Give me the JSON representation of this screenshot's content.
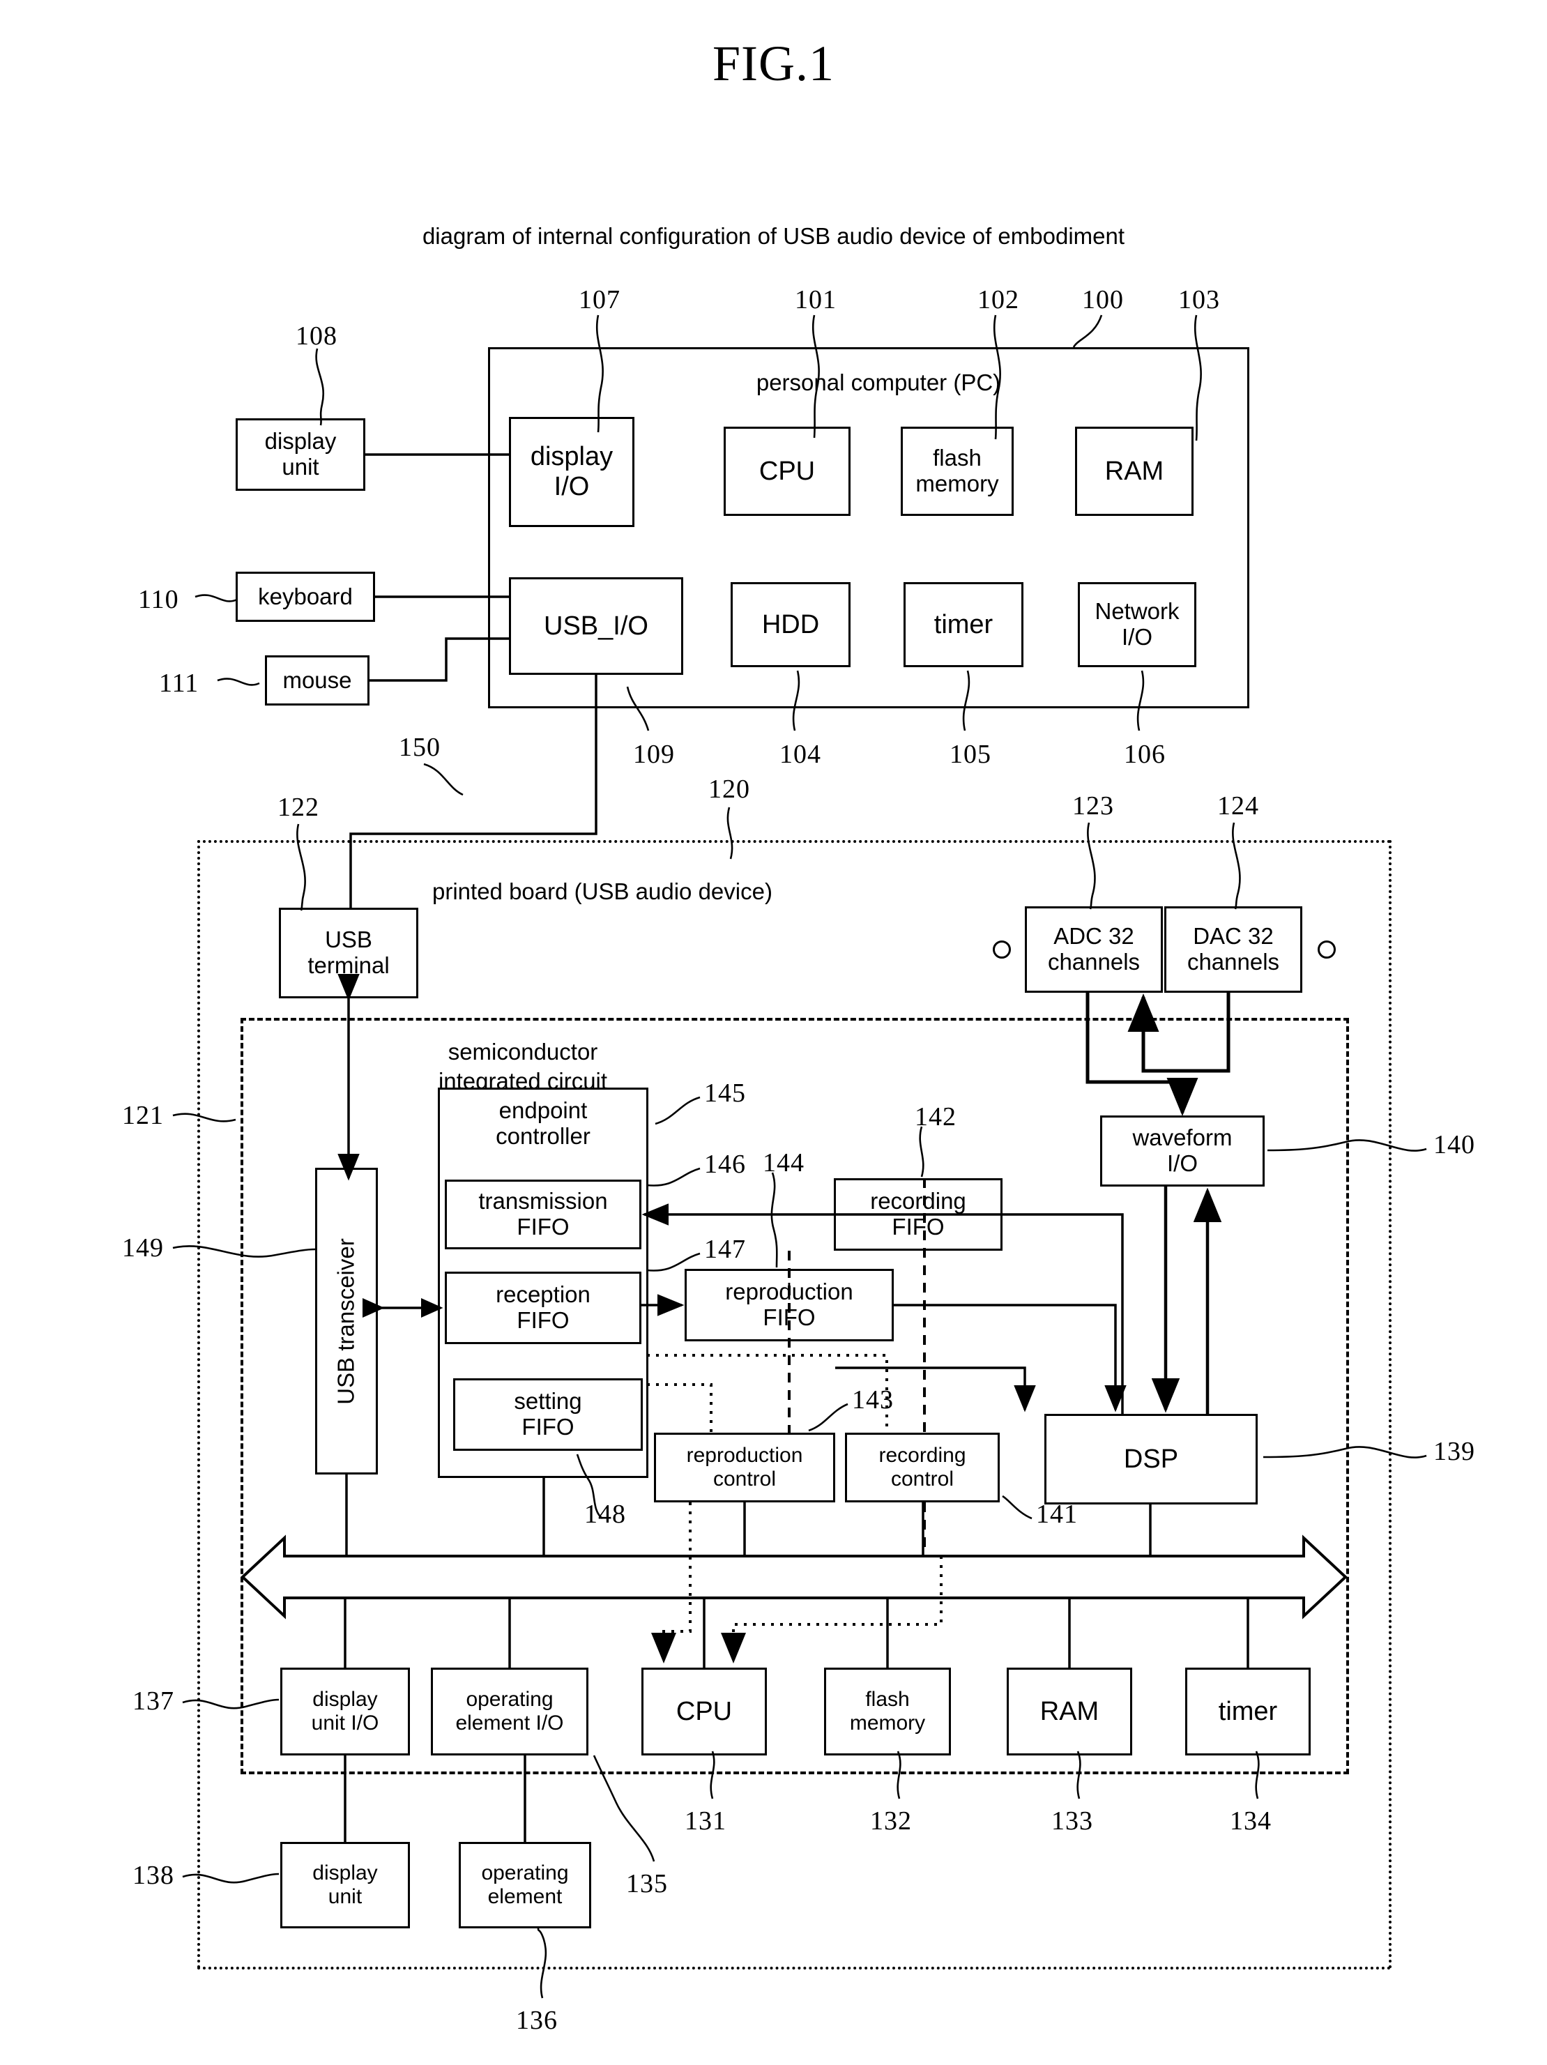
{
  "figure": {
    "title": "FIG.1",
    "caption": "diagram of internal configuration of USB audio device of embodiment"
  },
  "pc": {
    "title": "personal computer (PC)",
    "ref": "100",
    "blocks": [
      {
        "label": "display\nI/O",
        "ref": "107"
      },
      {
        "label": "CPU",
        "ref": "101"
      },
      {
        "label": "flash\nmemory",
        "ref": "102"
      },
      {
        "label": "RAM",
        "ref": "103"
      },
      {
        "label": "USB_I/O",
        "ref": "109"
      },
      {
        "label": "HDD",
        "ref": "104"
      },
      {
        "label": "timer",
        "ref": "105"
      },
      {
        "label": "Network\nI/O",
        "ref": "106"
      }
    ],
    "peripherals": [
      {
        "label": "display\nunit",
        "ref": "108"
      },
      {
        "label": "keyboard",
        "ref": "110"
      },
      {
        "label": "mouse",
        "ref": "111"
      }
    ]
  },
  "cable": {
    "ref": "150"
  },
  "board": {
    "title": "printed board (USB audio device)",
    "ref": "120",
    "usb_terminal": {
      "label": "USB\nterminal",
      "ref": "122"
    },
    "converters": [
      {
        "label": "ADC 32\nchannels",
        "ref": "123"
      },
      {
        "label": "DAC 32\nchannels",
        "ref": "124"
      }
    ],
    "external": [
      {
        "label": "display\nunit",
        "ref": "138"
      },
      {
        "label": "operating\nelement",
        "ref": "136"
      }
    ]
  },
  "ic": {
    "title": "semiconductor\nintegrated circuit",
    "title_line1": "semiconductor",
    "title_line2": "integrated circuit",
    "ref": "121",
    "transceiver": {
      "label": "USB transceiver",
      "ref": "149"
    },
    "endpoint_controller": {
      "label": "endpoint\ncontroller",
      "ref": "145"
    },
    "fifos": [
      {
        "label": "transmission\nFIFO",
        "ref": "146"
      },
      {
        "label": "reception\nFIFO",
        "ref": "147"
      },
      {
        "label": "setting\nFIFO",
        "ref": "148"
      }
    ],
    "data_fifos": [
      {
        "label": "recording\nFIFO",
        "ref": "142"
      },
      {
        "label": "reproduction\nFIFO",
        "ref": "144"
      }
    ],
    "controls": [
      {
        "label": "reproduction\ncontrol",
        "ref": "143"
      },
      {
        "label": "recording\ncontrol",
        "ref": "141"
      }
    ],
    "dsp": {
      "label": "DSP",
      "ref": "139"
    },
    "waveform_io": {
      "label": "waveform\nI/O",
      "ref": "140"
    },
    "bus_blocks": [
      {
        "label": "display\nunit I/O",
        "ref": "137"
      },
      {
        "label": "operating\nelement I/O",
        "ref": "135"
      },
      {
        "label": "CPU",
        "ref": "131"
      },
      {
        "label": "flash\nmemory",
        "ref": "132"
      },
      {
        "label": "RAM",
        "ref": "133"
      },
      {
        "label": "timer",
        "ref": "134"
      }
    ]
  },
  "labels": {
    "endpoint_controller": "endpoint\ncontroller",
    "transmission_fifo": "transmission\nFIFO",
    "reception_fifo": "reception\nFIFO",
    "setting_fifo": "setting\nFIFO",
    "recording_fifo": "recording\nFIFO",
    "reproduction_fifo": "reproduction\nFIFO",
    "reproduction_control": "reproduction\ncontrol",
    "recording_control": "recording\ncontrol",
    "dsp": "DSP",
    "waveform_io": "waveform\nI/O",
    "usb_transceiver": "USB transceiver",
    "usb_terminal": "USB\nterminal",
    "adc": "ADC 32\nchannels",
    "dac": "DAC 32\nchannels",
    "display_io_pc": "display\nI/O",
    "cpu": "CPU",
    "flash_memory": "flash\nmemory",
    "ram": "RAM",
    "usb_io": "USB_I/O",
    "hdd": "HDD",
    "timer": "timer",
    "network_io": "Network\nI/O",
    "display_unit": "display\nunit",
    "keyboard": "keyboard",
    "mouse": "mouse",
    "display_unit_io": "display\nunit I/O",
    "operating_element_io": "operating\nelement I/O",
    "operating_element": "operating\nelement"
  },
  "refs": {
    "r100": "100",
    "r101": "101",
    "r102": "102",
    "r103": "103",
    "r104": "104",
    "r105": "105",
    "r106": "106",
    "r107": "107",
    "r108": "108",
    "r109": "109",
    "r110": "110",
    "r111": "111",
    "r120": "120",
    "r121": "121",
    "r122": "122",
    "r123": "123",
    "r124": "124",
    "r131": "131",
    "r132": "132",
    "r133": "133",
    "r134": "134",
    "r135": "135",
    "r136": "136",
    "r137": "137",
    "r138": "138",
    "r139": "139",
    "r140": "140",
    "r141": "141",
    "r142": "142",
    "r143": "143",
    "r144": "144",
    "r145": "145",
    "r146": "146",
    "r147": "147",
    "r148": "148",
    "r149": "149",
    "r150": "150"
  },
  "colors": {
    "ink": "#000000",
    "paper": "#ffffff"
  }
}
